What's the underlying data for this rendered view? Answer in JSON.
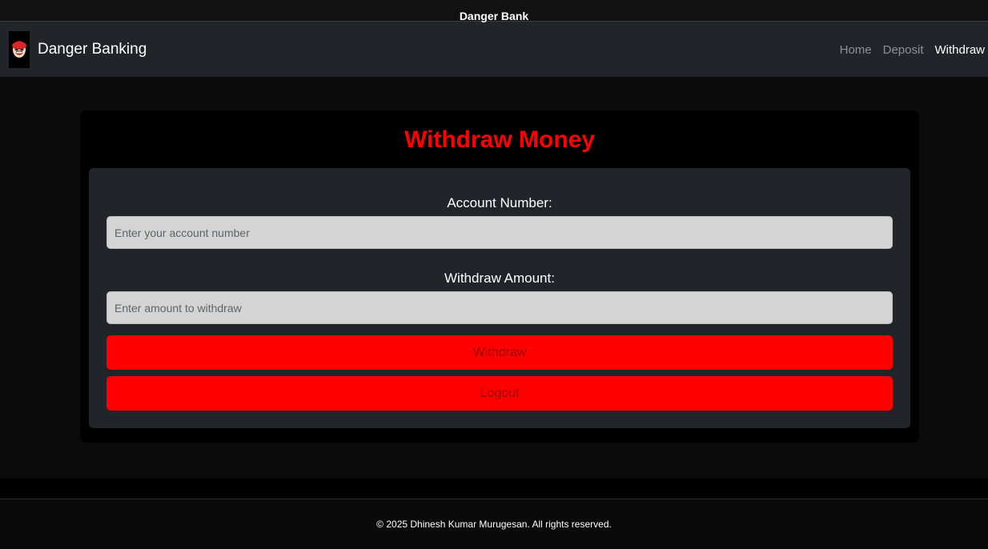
{
  "navbar": {
    "brand": "Danger Banking",
    "logo_icon": "mask-icon",
    "links": [
      {
        "label": "Home",
        "active": false
      },
      {
        "label": "Deposit",
        "active": false
      },
      {
        "label": "Withdraw",
        "active": true
      }
    ]
  },
  "card": {
    "title": "Withdraw Money",
    "account_label": "Account Number:",
    "account_placeholder": "Enter your account number",
    "account_value": "",
    "amount_label": "Withdraw Amount:",
    "amount_placeholder": "Enter amount to withdraw",
    "amount_value": "",
    "withdraw_button": "Withdraw",
    "logout_button": "Logout"
  },
  "footer": {
    "brand": "Danger Bank",
    "copyright": "© 2025 Dhinesh Kumar Murugesan. All rights reserved."
  },
  "colors": {
    "accent": "#ff0000",
    "navbar_bg": "#212529",
    "page_bg": "#0b0b0b"
  }
}
